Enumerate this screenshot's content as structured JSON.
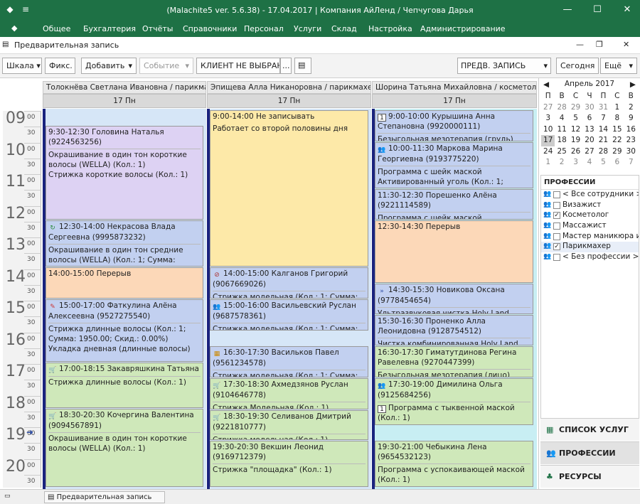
{
  "window": {
    "title": "(Malachite5 ver. 5.6.38) - 17.04.2017 | Компания АйЛенд / Чепчугова Дарья"
  },
  "menu": [
    "Общее",
    "Бухгалтерия",
    "Отчёты",
    "Справочники",
    "Персонал",
    "Услуги",
    "Склад",
    "Настройка",
    "Администрирование"
  ],
  "doc": {
    "title": "Предварительная запись"
  },
  "toolbar": {
    "scale": "Шкала",
    "fix": "Фикс.",
    "add": "Добавить",
    "event": "Событие",
    "client": "КЛИЕНТ НЕ ВЫБРАН",
    "ellipsis": "...",
    "mode": "ПРЕДВ. ЗАПИСЬ",
    "today": "Сегодня",
    "more": "Ещё"
  },
  "columns": [
    {
      "name": "Толокнёва Светлана Ивановна / парикмахер",
      "day": "17 Пн"
    },
    {
      "name": "Эпищева Алла Никаноровна / парикмахер",
      "day": "17 Пн"
    },
    {
      "name": "Шорина Татьяна Михайловна / косметолог",
      "day": "17 Пн"
    }
  ],
  "hours": [
    "09",
    "10",
    "11",
    "12",
    "13",
    "14",
    "15",
    "16",
    "17",
    "18",
    "19",
    "20"
  ],
  "minutes": [
    "00",
    "30"
  ],
  "col1": [
    {
      "h": "9:30-12:30 Головина Наталья (9224563256)",
      "d": "Окрашивание в один тон короткие волосы (WELLA) (Кол.: 1)\nСтрижка короткие волосы (Кол.: 1)"
    },
    {
      "h": "12:30-14:00 Некрасова Влада Сергеевна (9995873232)",
      "d": "Окрашивание в один тон средние волосы (WELLA) (Кол.: 1; Сумма: 3500.00;"
    },
    {
      "h": "14:00-15:00 Перерыв",
      "d": ""
    },
    {
      "h": "15:00-17:00 Фаткулина Алёна Алексеевна (9527275540)",
      "d": "Стрижка длинные волосы (Кол.: 1; Сумма: 1950.00; Скид.: 0.00%)\nУкладка дневная (длинные волосы)"
    },
    {
      "h": "17:00-18:15 Закавряшкина Татьяна",
      "d": "Стрижка длинные волосы (Кол.: 1)"
    },
    {
      "h": "18:30-20:30 Кочергина Валентина (9094567891)",
      "d": "Окрашивание в один тон короткие волосы (WELLA) (Кол.: 1)"
    }
  ],
  "col2": [
    {
      "h": "9:00-14:00 Не записывать",
      "d": "Работает со второй половины дня"
    },
    {
      "h": "14:00-15:00 Калганов Григорий (9067669026)",
      "d": "Стрижка модельная (Кол.: 1; Сумма:"
    },
    {
      "h": "15:00-16:00 Васильевский Руслан (9687578361)",
      "d": "Стрижка модельная (Кол.: 1; Сумма:"
    },
    {
      "h": "16:30-17:30 Васильков Павел (9561234578)",
      "d": "Стрижка модельная (Кол.: 1; Сумма:"
    },
    {
      "h": "17:30-18:30 Ахмедзянов Руслан (9104646778)",
      "d": "Стрижка Модельная (Кол.: 1)"
    },
    {
      "h": "18:30-19:30 Селиванов Дмитрий (9221810777)",
      "d": "Стрижка модельная (Кол.: 1)"
    },
    {
      "h": "19:30-20:30 Векшин Леонид (9169712379)",
      "d": "Стрижка \"площадка\" (Кол.: 1)"
    }
  ],
  "col3": [
    {
      "h": "9:00-10:00 Курышина Анна Степановна (9920000111)",
      "d": "Безыгольная мезотерапия (грудь) (Кол.:"
    },
    {
      "h": "10:00-11:30 Маркова Марина Георгиевна (9193775220)",
      "d": "Программа с шейк маской Активированный уголь (Кол.: 1; Сумма:"
    },
    {
      "h": "11:30-12:30 Порешенко Алёна (9221114589)",
      "d": "Программа с шейк маской"
    },
    {
      "h": "12:30-14:30 Перерыв",
      "d": ""
    },
    {
      "h": "14:30-15:30 Новикова Оксана (9778454654)",
      "d": "Ультразвуковая чистка Holy Land (Кол.:"
    },
    {
      "h": "15:30-16:30 Проненко Алла Леонидовна (9128754512)",
      "d": "Чистка комбинированная Holy Land (Кол.:"
    },
    {
      "h": "16:30-17:30 Гиматутдинова Регина Равелевна (9270447399)",
      "d": "Безыгольная мезотерапия (лицо) (Кол.: 1"
    },
    {
      "h": "17:30-19:00 Димилина Ольга (9125684256)",
      "d": "Программа с тыквенной маской (Кол.: 1)"
    },
    {
      "h": "19:30-21:00 Чебыкина Лена (9654532123)",
      "d": "Программа с успокаивающей маской (Кол.: 1)"
    }
  ],
  "calendar": {
    "month": "Апрель 2017",
    "weekdays": [
      "П",
      "В",
      "С",
      "Ч",
      "П",
      "С",
      "В"
    ],
    "days": [
      "27",
      "28",
      "29",
      "30",
      "31",
      "1",
      "2",
      "3",
      "4",
      "5",
      "6",
      "7",
      "8",
      "9",
      "10",
      "11",
      "12",
      "13",
      "14",
      "15",
      "16",
      "17",
      "18",
      "19",
      "20",
      "21",
      "22",
      "23",
      "24",
      "25",
      "26",
      "27",
      "28",
      "29",
      "30",
      "1",
      "2",
      "3",
      "4",
      "5",
      "6",
      "7"
    ]
  },
  "professions": {
    "header": "ПРОФЕССИИ",
    "items": [
      {
        "label": "< Все сотрудники >",
        "checked": false
      },
      {
        "label": "Визажист",
        "checked": false
      },
      {
        "label": "Косметолог",
        "checked": true
      },
      {
        "label": "Массажист",
        "checked": false
      },
      {
        "label": "Мастер маникюра и",
        "checked": false
      },
      {
        "label": "Парикмахер",
        "checked": true
      },
      {
        "label": "< Без профессии >",
        "checked": false
      }
    ]
  },
  "panes": [
    "СПИСОК УСЛУГ",
    "ПРОФЕССИИ",
    "РЕСУРСЫ"
  ],
  "status": {
    "tab": "Предварительная запись"
  },
  "colors": {
    "accent": "#1e7145",
    "time_bar": "#1a237e"
  }
}
